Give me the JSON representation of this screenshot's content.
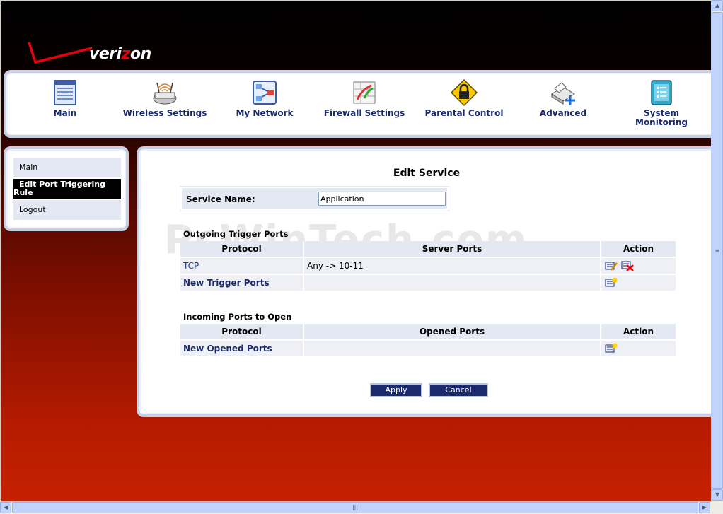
{
  "brand": {
    "name": "verizon",
    "name_pre": "veri",
    "name_z": "z",
    "name_post": "on"
  },
  "nav": [
    {
      "label": "Main",
      "icon": "main-page-icon"
    },
    {
      "label": "Wireless Settings",
      "icon": "wireless-router-icon"
    },
    {
      "label": "My Network",
      "icon": "network-map-icon"
    },
    {
      "label": "Firewall Settings",
      "icon": "firewall-icon"
    },
    {
      "label": "Parental Control",
      "icon": "padlock-icon"
    },
    {
      "label": "Advanced",
      "icon": "advanced-tools-icon"
    },
    {
      "label": "System Monitoring",
      "icon": "monitor-icon"
    }
  ],
  "sidebar": {
    "items": [
      {
        "label": "Main",
        "active": false
      },
      {
        "label": "Edit Port Triggering Rule",
        "active": true
      },
      {
        "label": "Logout",
        "active": false
      }
    ]
  },
  "content": {
    "title": "Edit Service",
    "watermark": "PcWinTech.com",
    "service_name": {
      "label": "Service Name:",
      "value": "Application"
    },
    "outgoing": {
      "title": "Outgoing Trigger Ports",
      "headers": [
        "Protocol",
        "Server Ports",
        "Action"
      ],
      "rows": [
        {
          "protocol": "TCP",
          "ports": "Any -> 10-11",
          "actions": [
            "edit-icon",
            "delete-icon"
          ]
        }
      ],
      "new_label": "New Trigger Ports",
      "new_action": "add-icon"
    },
    "incoming": {
      "title": "Incoming Ports to Open",
      "headers": [
        "Protocol",
        "Opened Ports",
        "Action"
      ],
      "new_label": "New Opened Ports",
      "new_action": "add-icon"
    },
    "buttons": {
      "apply": "Apply",
      "cancel": "Cancel"
    }
  },
  "colors": {
    "nav_text": "#1b2a6b",
    "panel_border": "#c7cfe0",
    "row_bg": "#e3e8f3",
    "button_bg": "#1b2a6b",
    "active_bg": "#000000",
    "brand_red": "#e8000b"
  }
}
